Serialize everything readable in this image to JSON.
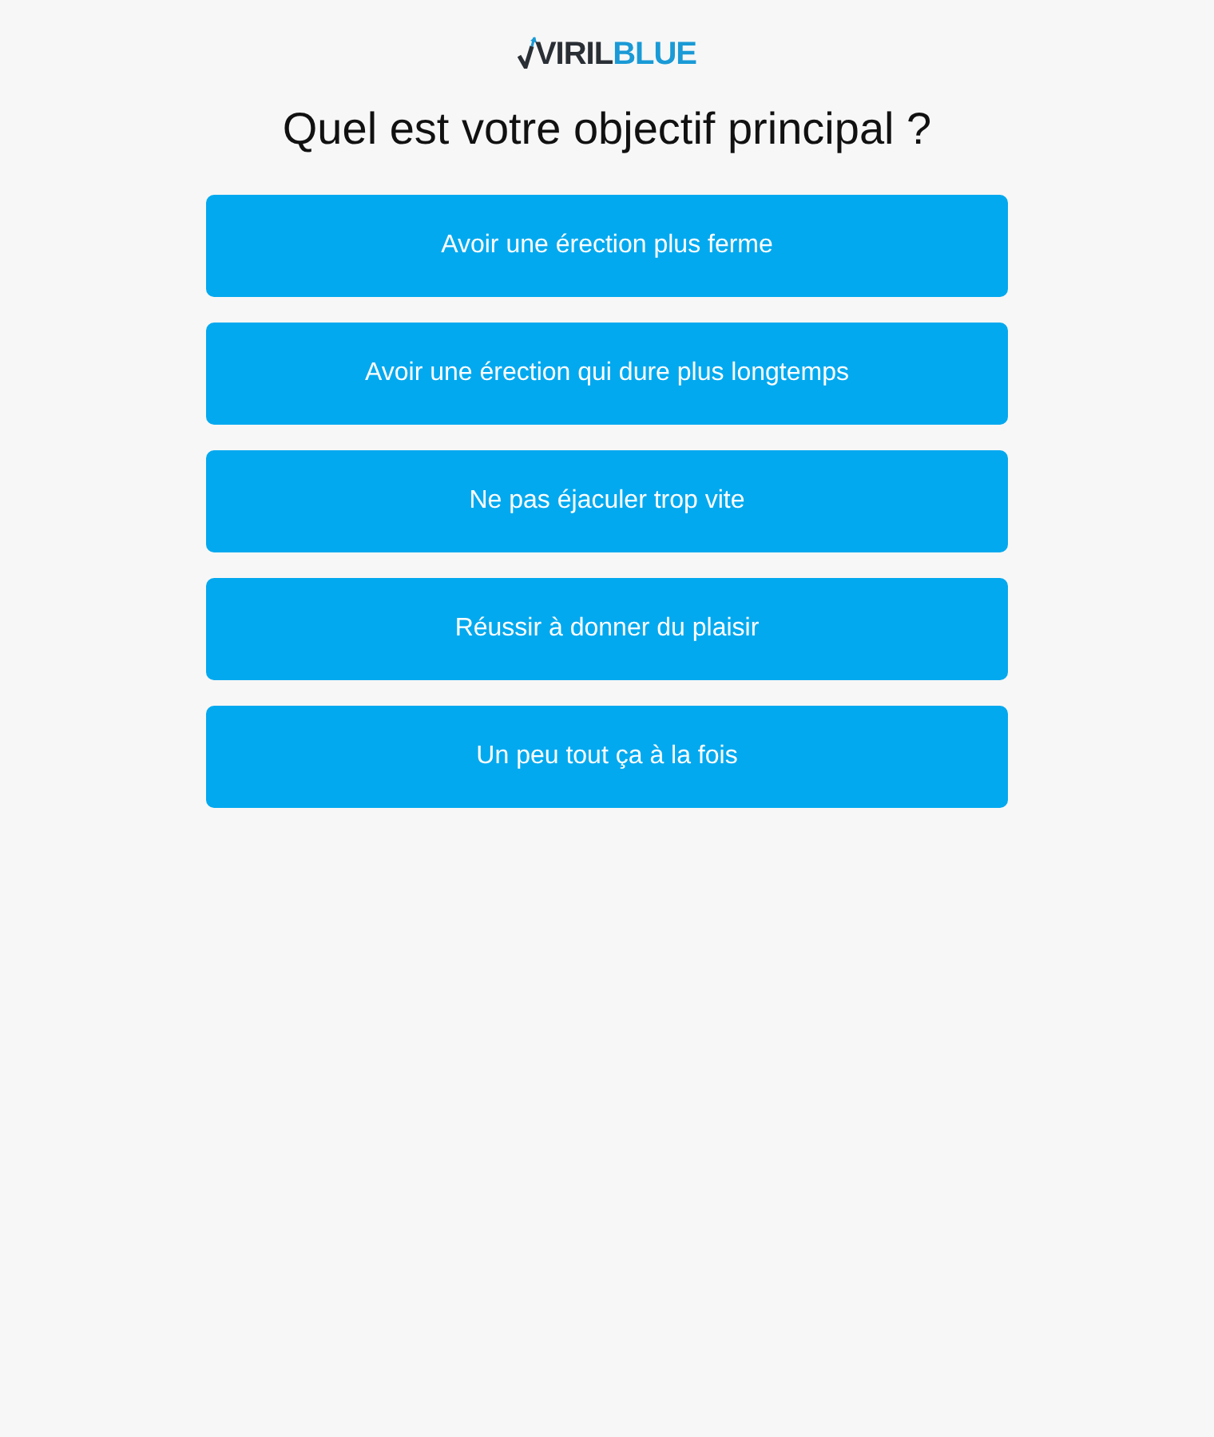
{
  "logo": {
    "part_1": "VIRIL",
    "part_2": "BLUE"
  },
  "question": "Quel est votre objectif principal ?",
  "options": [
    {
      "label": "Avoir une érection plus ferme"
    },
    {
      "label": "Avoir une érection qui dure plus longtemps"
    },
    {
      "label": "Ne pas éjaculer trop vite"
    },
    {
      "label": "Réussir à donner du plaisir"
    },
    {
      "label": "Un peu tout ça à la fois"
    }
  ]
}
